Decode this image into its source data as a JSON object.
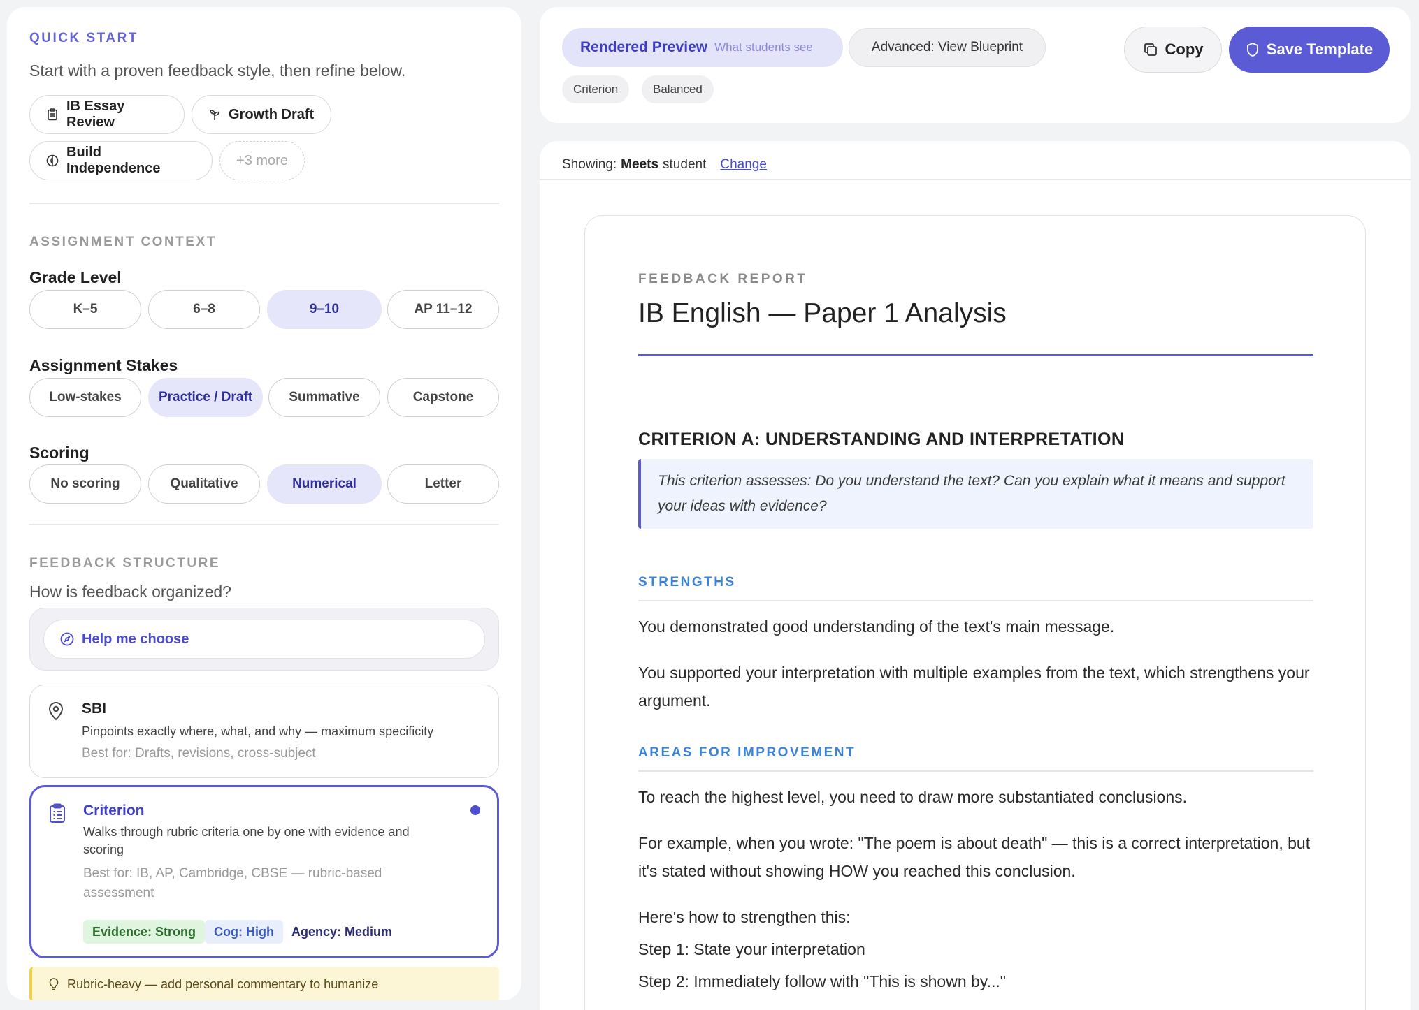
{
  "quick_start": {
    "label": "QUICK START",
    "subtitle": "Start with a proven feedback style, then refine below.",
    "presets": [
      {
        "label": "IB Essay Review",
        "icon": "clipboard-icon"
      },
      {
        "label": "Growth Draft",
        "icon": "sprout-icon"
      },
      {
        "label": "Build Independence",
        "icon": "compass-half-icon"
      }
    ],
    "more": "+3 more"
  },
  "assignment_context": {
    "label": "ASSIGNMENT CONTEXT",
    "grade_level": {
      "title": "Grade Level",
      "options": [
        "K–5",
        "6–8",
        "9–10",
        "AP 11–12"
      ],
      "selected": "9–10"
    },
    "stakes": {
      "title": "Assignment Stakes",
      "options": [
        "Low-stakes",
        "Practice / Draft",
        "Summative",
        "Capstone"
      ],
      "selected": "Practice / Draft"
    },
    "scoring": {
      "title": "Scoring",
      "options": [
        "No scoring",
        "Qualitative",
        "Numerical",
        "Letter"
      ],
      "selected": "Numerical"
    }
  },
  "feedback_structure": {
    "label": "FEEDBACK STRUCTURE",
    "question": "How is feedback organized?",
    "help_button": "Help me choose",
    "options": [
      {
        "title": "SBI",
        "description": "Pinpoints exactly where, what, and why — maximum specificity",
        "best_for": "Best for: Drafts, revisions, cross-subject",
        "icon": "map-pin-icon"
      },
      {
        "title": "Criterion",
        "description": "Walks through rubric criteria one by one with evidence and scoring",
        "best_for": "Best for: IB, AP, Cambridge, CBSE — rubric-based assessment",
        "icon": "clipboard-list-icon",
        "selected": true,
        "tags": [
          "Evidence: Strong",
          "Cog: High",
          "Agency: Medium"
        ]
      }
    ],
    "tip": "Rubric-heavy — add personal commentary to humanize"
  },
  "toolbar": {
    "preview_tab": "Rendered Preview",
    "preview_hint": "What students see",
    "advanced_tab": "Advanced: View Blueprint",
    "chips": [
      "Criterion",
      "Balanced"
    ],
    "copy": "Copy",
    "save": "Save Template"
  },
  "showing": {
    "prefix": "Showing:",
    "level": "Meets",
    "suffix": "student",
    "change": "Change"
  },
  "report": {
    "label": "FEEDBACK REPORT",
    "title": "IB English — Paper 1 Analysis",
    "criterion_heading": "CRITERION A: UNDERSTANDING AND INTERPRETATION",
    "criterion_desc": "This criterion assesses: Do you understand the text? Can you explain what it means and support your ideas with evidence?",
    "strengths_heading": "STRENGTHS",
    "strengths": [
      "You demonstrated good understanding of the text's main message.",
      "You supported your interpretation with multiple examples from the text, which strengthens your argument."
    ],
    "improvement_heading": "AREAS FOR IMPROVEMENT",
    "improvement": [
      "To reach the highest level, you need to draw more substantiated conclusions.",
      "For example, when you wrote: \"The poem is about death\" — this is a correct interpretation, but it's stated without showing HOW you reached this conclusion.",
      "Here's how to strengthen this:",
      "Step 1: State your interpretation",
      "Step 2: Immediately follow with \"This is shown by...\""
    ]
  },
  "colors": {
    "accent": "#5b5bd6",
    "accent_light": "#e6e6fb",
    "section_blue": "#3b82d9"
  }
}
